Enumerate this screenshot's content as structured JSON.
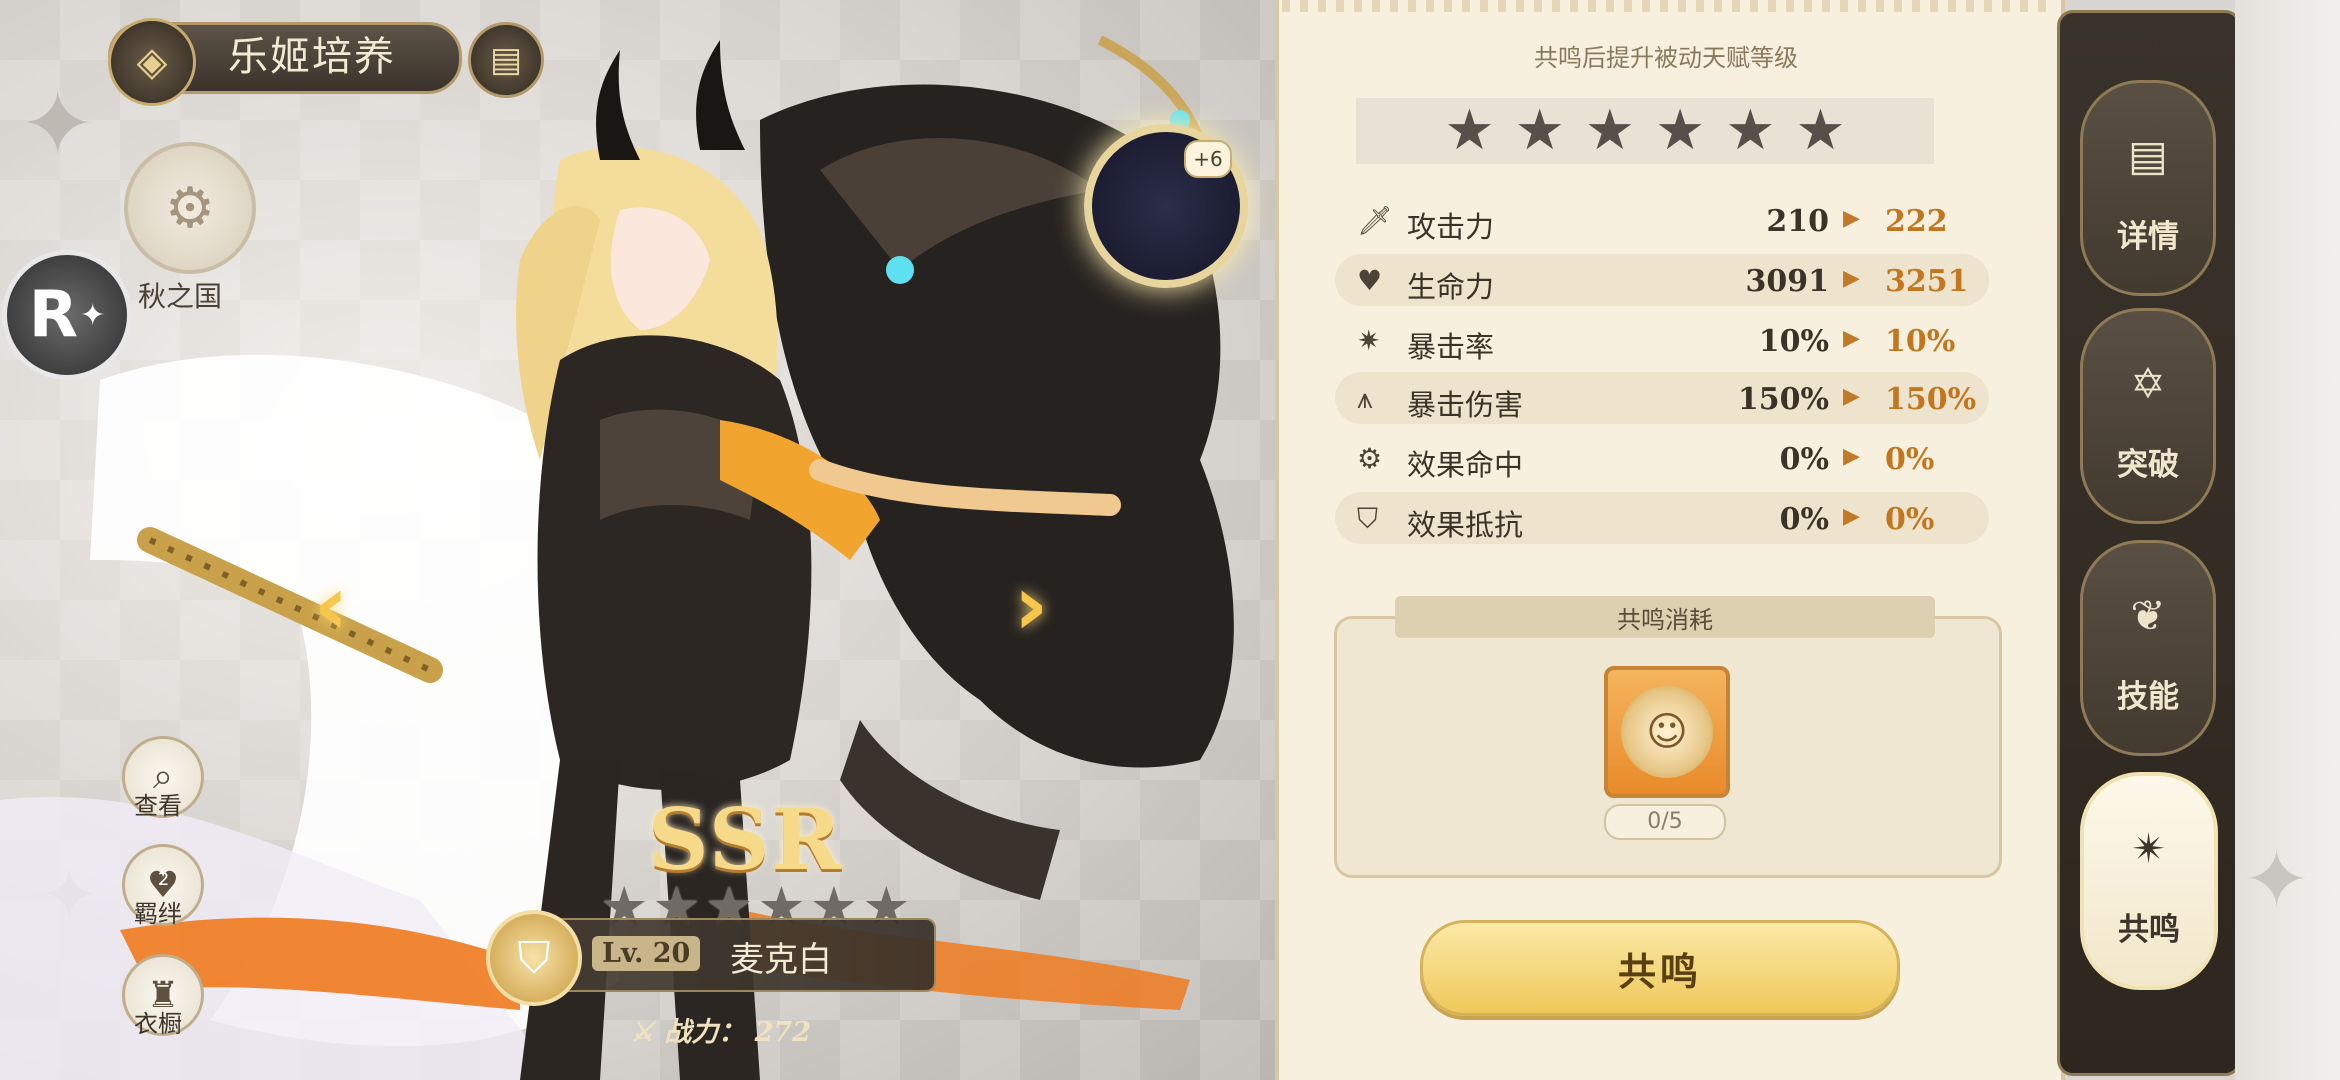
{
  "header": {
    "title": "乐姬培养"
  },
  "nation": {
    "label": "秋之国"
  },
  "rank_badge": {
    "text": "R"
  },
  "side_buttons": [
    {
      "label": "查看",
      "icon": "magnifier-icon"
    },
    {
      "label": "羁绊",
      "icon": "heart-icon",
      "value": "2"
    },
    {
      "label": "衣橱",
      "icon": "wardrobe-icon"
    }
  ],
  "character": {
    "rarity": "SSR",
    "stars_total": 6,
    "level": "Lv. 20",
    "name": "麦克白",
    "power_label": "战力：",
    "power_value": "272",
    "gem_plus": "+6"
  },
  "panel": {
    "heading": "共鸣后提升被动天赋等级",
    "stars_total": 6,
    "stats": [
      {
        "icon": "sword-icon",
        "label": "攻击力",
        "current": "210",
        "next": "222"
      },
      {
        "icon": "heart-icon",
        "label": "生命力",
        "current": "3091",
        "next": "3251"
      },
      {
        "icon": "burst-icon",
        "label": "暴击率",
        "current": "10%",
        "next": "10%"
      },
      {
        "icon": "splash-icon",
        "label": "暴击伤害",
        "current": "150%",
        "next": "150%"
      },
      {
        "icon": "gear-icon",
        "label": "效果命中",
        "current": "0%",
        "next": "0%"
      },
      {
        "icon": "shield-icon",
        "label": "效果抵抗",
        "current": "0%",
        "next": "0%"
      }
    ],
    "cost": {
      "title": "共鸣消耗",
      "count": "0/5"
    },
    "action_button": "共鸣"
  },
  "tabs": [
    {
      "label": "详情",
      "icon": "document-icon",
      "active": false
    },
    {
      "label": "突破",
      "icon": "hexagram-icon",
      "active": false
    },
    {
      "label": "技能",
      "icon": "leaf-icon",
      "active": false
    },
    {
      "label": "共鸣",
      "icon": "resonance-star-icon",
      "active": true
    }
  ],
  "colors": {
    "accent_gold": "#f6c64d",
    "stat_next": "#c2771f",
    "panel_bg": "#f7f0df",
    "tab_dark": "#433a30"
  }
}
